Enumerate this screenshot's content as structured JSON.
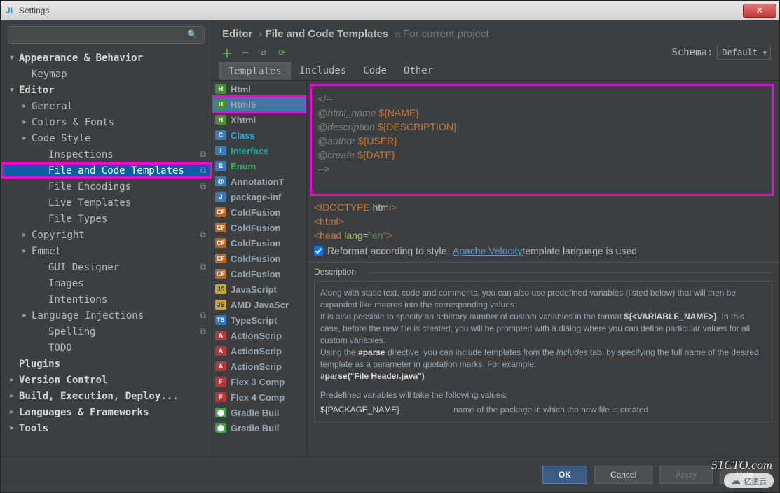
{
  "window": {
    "title": "Settings"
  },
  "search": {
    "placeholder": ""
  },
  "tree": [
    {
      "label": "Appearance & Behavior",
      "lvl": 0,
      "arrow": "▾",
      "bold": true
    },
    {
      "label": "Keymap",
      "lvl": 1,
      "arrow": "",
      "bold": false
    },
    {
      "label": "Editor",
      "lvl": 0,
      "arrow": "▾",
      "bold": true
    },
    {
      "label": "General",
      "lvl": 1,
      "arrow": "▸",
      "bold": false
    },
    {
      "label": "Colors & Fonts",
      "lvl": 1,
      "arrow": "▸",
      "bold": false
    },
    {
      "label": "Code Style",
      "lvl": 1,
      "arrow": "▸",
      "bold": false
    },
    {
      "label": "Inspections",
      "lvl": 2,
      "arrow": "",
      "bold": false,
      "proj": true
    },
    {
      "label": "File and Code Templates",
      "lvl": 2,
      "arrow": "",
      "bold": false,
      "proj": true,
      "selected": true,
      "highlight": true
    },
    {
      "label": "File Encodings",
      "lvl": 2,
      "arrow": "",
      "bold": false,
      "proj": true
    },
    {
      "label": "Live Templates",
      "lvl": 2,
      "arrow": "",
      "bold": false
    },
    {
      "label": "File Types",
      "lvl": 2,
      "arrow": "",
      "bold": false
    },
    {
      "label": "Copyright",
      "lvl": 1,
      "arrow": "▸",
      "bold": false,
      "proj": true
    },
    {
      "label": "Emmet",
      "lvl": 1,
      "arrow": "▸",
      "bold": false
    },
    {
      "label": "GUI Designer",
      "lvl": 2,
      "arrow": "",
      "bold": false,
      "proj": true
    },
    {
      "label": "Images",
      "lvl": 2,
      "arrow": "",
      "bold": false
    },
    {
      "label": "Intentions",
      "lvl": 2,
      "arrow": "",
      "bold": false
    },
    {
      "label": "Language Injections",
      "lvl": 1,
      "arrow": "▸",
      "bold": false,
      "proj": true
    },
    {
      "label": "Spelling",
      "lvl": 2,
      "arrow": "",
      "bold": false,
      "proj": true
    },
    {
      "label": "TODO",
      "lvl": 2,
      "arrow": "",
      "bold": false
    },
    {
      "label": "Plugins",
      "lvl": 0,
      "arrow": "",
      "bold": true
    },
    {
      "label": "Version Control",
      "lvl": 0,
      "arrow": "▸",
      "bold": true
    },
    {
      "label": "Build, Execution, Deploy...",
      "lvl": 0,
      "arrow": "▸",
      "bold": true
    },
    {
      "label": "Languages & Frameworks",
      "lvl": 0,
      "arrow": "▸",
      "bold": true
    },
    {
      "label": "Tools",
      "lvl": 0,
      "arrow": "▸",
      "bold": true
    }
  ],
  "breadcrumb": {
    "a": "Editor",
    "b": "File and Code Templates",
    "suffix": "For current project"
  },
  "schema": {
    "label": "Schema:",
    "value": "Default"
  },
  "tabs": [
    "Templates",
    "Includes",
    "Code",
    "Other"
  ],
  "activeTab": 0,
  "templates": [
    {
      "label": "Html",
      "icon": "ic-html",
      "glyph": "H",
      "color": "c-default"
    },
    {
      "label": "Html5",
      "icon": "ic-html",
      "glyph": "H",
      "color": "c-default",
      "selected": true,
      "highlight": true
    },
    {
      "label": "Xhtml",
      "icon": "ic-html",
      "glyph": "H",
      "color": "c-default"
    },
    {
      "label": "Class",
      "icon": "ic-class",
      "glyph": "C",
      "color": "c-blue"
    },
    {
      "label": "Interface",
      "icon": "ic-class",
      "glyph": "I",
      "color": "c-teal"
    },
    {
      "label": "Enum",
      "icon": "ic-class",
      "glyph": "E",
      "color": "c-green"
    },
    {
      "label": "AnnotationT",
      "icon": "ic-class",
      "glyph": "@",
      "color": "c-default"
    },
    {
      "label": "package-inf",
      "icon": "ic-class",
      "glyph": "J",
      "color": "c-default"
    },
    {
      "label": "ColdFusion",
      "icon": "ic-cf",
      "glyph": "CF",
      "color": "c-default"
    },
    {
      "label": "ColdFusion",
      "icon": "ic-cf",
      "glyph": "CF",
      "color": "c-default"
    },
    {
      "label": "ColdFusion",
      "icon": "ic-cf",
      "glyph": "CF",
      "color": "c-default"
    },
    {
      "label": "ColdFusion",
      "icon": "ic-cf",
      "glyph": "CF",
      "color": "c-default"
    },
    {
      "label": "ColdFusion",
      "icon": "ic-cf",
      "glyph": "CF",
      "color": "c-default"
    },
    {
      "label": "JavaScript",
      "icon": "ic-js",
      "glyph": "JS",
      "color": "c-default"
    },
    {
      "label": "AMD JavaScr",
      "icon": "ic-js",
      "glyph": "JS",
      "color": "c-default"
    },
    {
      "label": "TypeScript",
      "icon": "ic-ts",
      "glyph": "TS",
      "color": "c-default"
    },
    {
      "label": "ActionScrip",
      "icon": "ic-as",
      "glyph": "A",
      "color": "c-default"
    },
    {
      "label": "ActionScrip",
      "icon": "ic-as",
      "glyph": "A",
      "color": "c-default"
    },
    {
      "label": "ActionScrip",
      "icon": "ic-as",
      "glyph": "A",
      "color": "c-default"
    },
    {
      "label": "Flex 3 Comp",
      "icon": "ic-fx",
      "glyph": "F",
      "color": "c-default"
    },
    {
      "label": "Flex 4 Comp",
      "icon": "ic-fx",
      "glyph": "F",
      "color": "c-default"
    },
    {
      "label": "Gradle Buil",
      "icon": "ic-gr",
      "glyph": "⬤",
      "color": "c-default"
    },
    {
      "label": "Gradle Buil",
      "icon": "ic-gr",
      "glyph": "⬤",
      "color": "c-default"
    }
  ],
  "code_comment": {
    "l1": "<!--",
    "l2a": "@html_name ",
    "l2b": "${NAME}",
    "l3a": "@description  ",
    "l3b": "${DESCRIPTION}",
    "l4a": "@author ",
    "l4b": "${USER}",
    "l5a": "@create  ",
    "l5b": "${DATE}",
    "l6": "-->"
  },
  "code_below": [
    "<!DOCTYPE html>",
    "<html>",
    "<head lang=\"en\">"
  ],
  "reformat": {
    "checked": true,
    "pre": "Reformat according to style",
    "link": "Apache Velocity",
    "post": " template language is used"
  },
  "description": {
    "title": "Description",
    "body_p1": "Along with static text, code and comments, you can also use predefined variables (listed below) that will then be expanded like macros into the corresponding values.",
    "body_p2_a": "It is also possible to specify an arbitrary number of custom variables in the format ",
    "body_p2_b": "${<VARIABLE_NAME>}",
    "body_p2_c": ". In this case, before the new file is created, you will be prompted with a dialog where you can define particular values for all custom variables.",
    "body_p3_a": "Using the ",
    "body_p3_b": "#parse",
    "body_p3_c": " directive, you can include templates from the ",
    "body_p3_d": "Includes",
    "body_p3_e": " tab, by specifying the full name of the desired template as a parameter in quotation marks. For example:",
    "body_p3_f": "#parse(\"File Header.java\")",
    "vars_head": "Predefined variables will take the following values:",
    "vars": [
      {
        "name": "${PACKAGE_NAME}",
        "desc": "name of the package in which the new file is created"
      }
    ]
  },
  "buttons": {
    "ok": "OK",
    "cancel": "Cancel",
    "apply": "Apply",
    "help": "Help"
  },
  "watermarks": {
    "w1": "51CTO.com",
    "w2": "亿速云"
  }
}
